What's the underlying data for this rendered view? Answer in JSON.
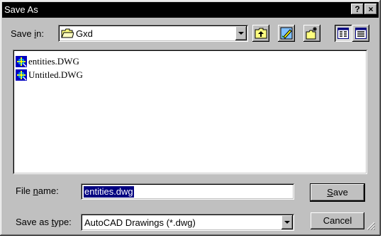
{
  "window": {
    "title": "Save As"
  },
  "titlebar": {
    "help_glyph": "?",
    "close_glyph": "×"
  },
  "save_in": {
    "label_prefix": "Save ",
    "label_accel": "i",
    "label_suffix": "n:",
    "folder": "Gxd"
  },
  "toolbar": {
    "icons": [
      "up-one-level-icon",
      "desktop-icon",
      "create-new-folder-icon",
      "list-view-icon",
      "details-view-icon"
    ]
  },
  "files": [
    {
      "name": "entities.DWG",
      "icon": "dwg-file-icon"
    },
    {
      "name": "Untitled.DWG",
      "icon": "dwg-file-icon"
    }
  ],
  "filename": {
    "label_prefix": "File ",
    "label_accel": "n",
    "label_suffix": "ame:",
    "value": "entities.dwg"
  },
  "filetype": {
    "label_prefix": "Save as ",
    "label_accel": "t",
    "label_suffix": "ype:",
    "value": "AutoCAD Drawings (*.dwg)"
  },
  "buttons": {
    "save_accel": "S",
    "save_rest": "ave",
    "cancel": "Cancel"
  },
  "colors": {
    "selection": "#000080",
    "face": "#c0c0c0",
    "icon_blue": "#0000c0"
  }
}
